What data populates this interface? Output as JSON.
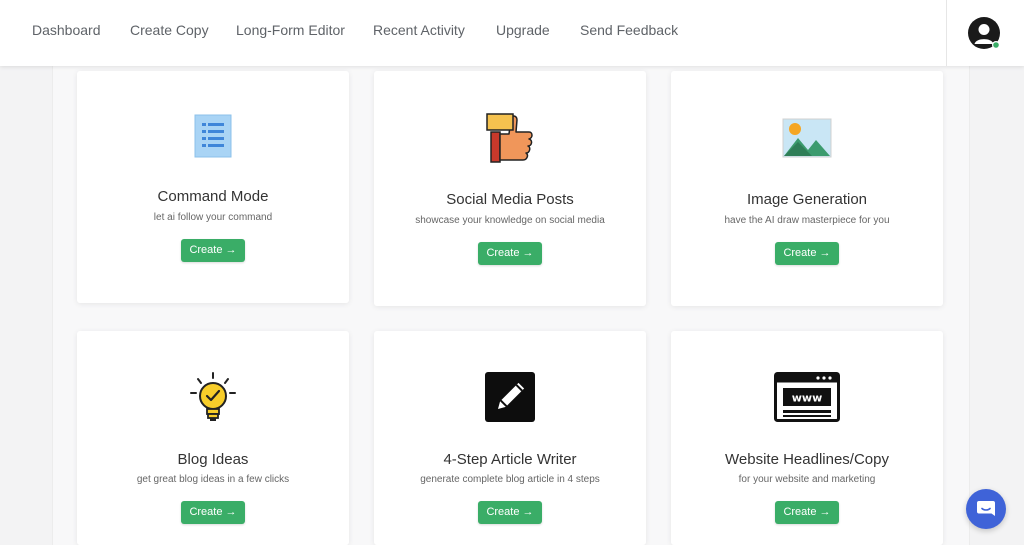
{
  "nav": {
    "items": [
      {
        "label": "Dashboard"
      },
      {
        "label": "Create Copy"
      },
      {
        "label": "Long-Form Editor"
      },
      {
        "label": "Recent Activity"
      },
      {
        "label": "Upgrade"
      },
      {
        "label": "Send Feedback"
      }
    ],
    "avatar_icon": "user-avatar-icon",
    "status_color": "#3aad67"
  },
  "cards": [
    {
      "title": "Command Mode",
      "description": "let ai follow your command",
      "button": "Create →",
      "icon": "list-icon"
    },
    {
      "title": "Social Media Posts",
      "description": "showcase your knowledge on social media",
      "button": "Create →",
      "icon": "thumbs-up-icon"
    },
    {
      "title": "Image Generation",
      "description": "have the AI draw masterpiece for you",
      "button": "Create →",
      "icon": "image-icon"
    },
    {
      "title": "Blog Ideas",
      "description": "get great blog ideas in a few clicks",
      "button": "Create →",
      "icon": "lightbulb-icon"
    },
    {
      "title": "4-Step Article Writer",
      "description": "generate complete blog article in 4 steps",
      "button": "Create →",
      "icon": "pencil-icon"
    },
    {
      "title": "Website Headlines/Copy",
      "description": "for your website and marketing",
      "button": "Create →",
      "icon": "www-browser-icon"
    }
  ],
  "chat": {
    "icon": "chat-icon"
  },
  "colors": {
    "accent": "#3aad67",
    "chat": "#3f63d8"
  }
}
